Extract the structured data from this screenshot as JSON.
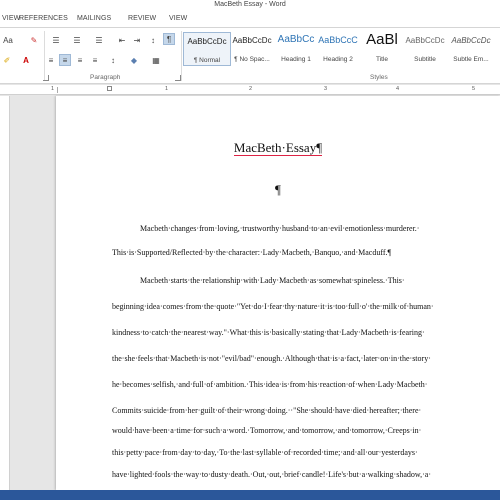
{
  "window": {
    "title": "MacBeth Essay - Word"
  },
  "tabs": [
    "VIEW",
    "REFERENCES",
    "MAILINGS",
    "REVIEW",
    "VIEW"
  ],
  "ribbon": {
    "groups": {
      "paragraph_label": "Paragraph",
      "styles_label": "Styles"
    },
    "font_size_label": "Aa",
    "styles": [
      {
        "sample": "AaBbCcDc",
        "name": "¶ Normal"
      },
      {
        "sample": "AaBbCcDc",
        "name": "¶ No Spac..."
      },
      {
        "sample": "AaBbCc",
        "name": "Heading 1"
      },
      {
        "sample": "AaBbCcC",
        "name": "Heading 2"
      },
      {
        "sample": "AaBl",
        "name": "Title"
      },
      {
        "sample": "AaBbCcDc",
        "name": "Subtitle"
      },
      {
        "sample": "AaBbCcDc",
        "name": "Subtle Em..."
      }
    ]
  },
  "ruler_numbers": [
    "1",
    "1",
    "2",
    "3",
    "4",
    "5"
  ],
  "document": {
    "title": "MacBeth·Essay¶",
    "pilcrow": "¶",
    "para1": [
      "Macbeth·changes·from·loving,·trustworthy·husband·to·an·evil·emotionless·murderer.·",
      "This·is·Supported/Reflected·by·the·character:·Lady·Macbeth,·Banquo,·and·Macduff.¶"
    ],
    "para2": [
      "Macbeth·starts·the·relationship·with·Lady·Macbeth·as·somewhat·spineless.·This·",
      "beginning·idea·comes·from·the·quote·\"Yet·do·I·fear·thy·nature·it·is·too·full·o'·the·milk·of·human·",
      "kindness·to·catch·the·nearest·way.\"·What·this·is·basically·stating·that·Lady·Macbeth·is·fearing·",
      "the·she·feels·that·Macbeth·is·not·\"evil/bad\"·enough.·Although·that·is·a·fact,·later·on·in·the·story·",
      "he·becomes·selfish,·and·full·of·ambition.·This·idea·is·from·his·reaction·of·when·Lady·Macbeth·",
      "Commits·suicide·from·her·guilt·of·their·wrong·doing.··\"She·should·have·died·hereafter;·there·",
      "would·have·been·a·time·for·such·a·word.·Tomorrow,·and·tomorrow,·and·tomorrow,·Creeps·in·",
      "this·petty·pace·from·day·to·day,·To·the·last·syllable·of·recorded·time;·and·all·our·yesterdays·",
      "have·lighted·fools·the·way·to·dusty·death.·Out,·out,·brief·candle!·Life's·but·a·walking·shadow,·a·"
    ]
  },
  "colors": {
    "statusbar": "#2b579a",
    "spellcheck_underline": "#dd2244"
  }
}
